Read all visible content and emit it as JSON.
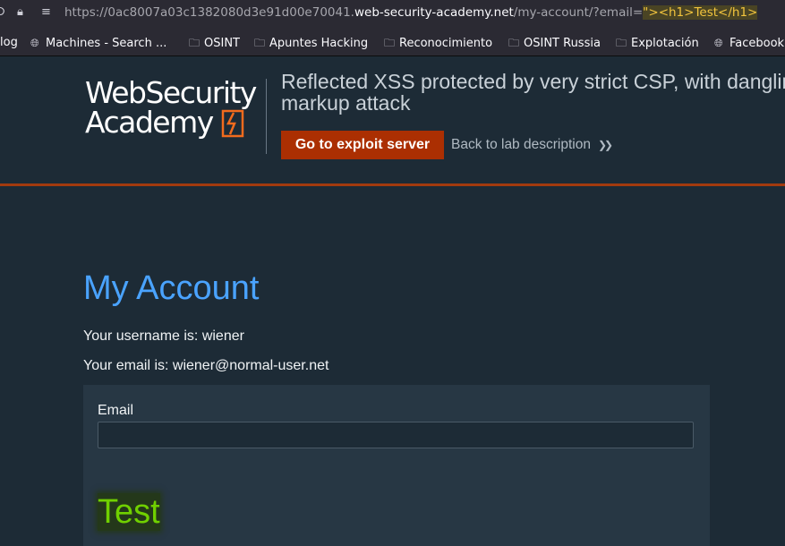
{
  "browser": {
    "url_prefix": "https://0ac8007a03c1382080d3e91d00e70041.",
    "url_domain": "web-security-academy.net",
    "url_path": "/my-account/?email=",
    "url_payload": "\"><h1>Test</h1>",
    "bookmarks": [
      {
        "label": "log",
        "icon": "none"
      },
      {
        "label": "Machines - Search ...",
        "icon": "globe-icon"
      },
      {
        "label": "OSINT",
        "icon": "folder-icon"
      },
      {
        "label": "Apuntes Hacking",
        "icon": "folder-icon"
      },
      {
        "label": "Reconocimiento",
        "icon": "folder-icon"
      },
      {
        "label": "OSINT Russia",
        "icon": "folder-icon"
      },
      {
        "label": "Explotación",
        "icon": "folder-icon"
      },
      {
        "label": "Facebook",
        "icon": "globe-icon"
      }
    ]
  },
  "lab": {
    "logo_line1": "WebSecurity",
    "logo_line2": "Academy",
    "title": "Reflected XSS protected by very strict CSP, with dangling markup attack",
    "exploit_button": "Go to exploit server",
    "back_link": "Back to lab description",
    "accent_color": "#ab2f02"
  },
  "account": {
    "heading": "My Account",
    "username_line": "Your username is: wiener",
    "email_line": "Your email is: wiener@normal-user.net",
    "email_label": "Email",
    "email_value": "",
    "injected_heading": "Test"
  }
}
